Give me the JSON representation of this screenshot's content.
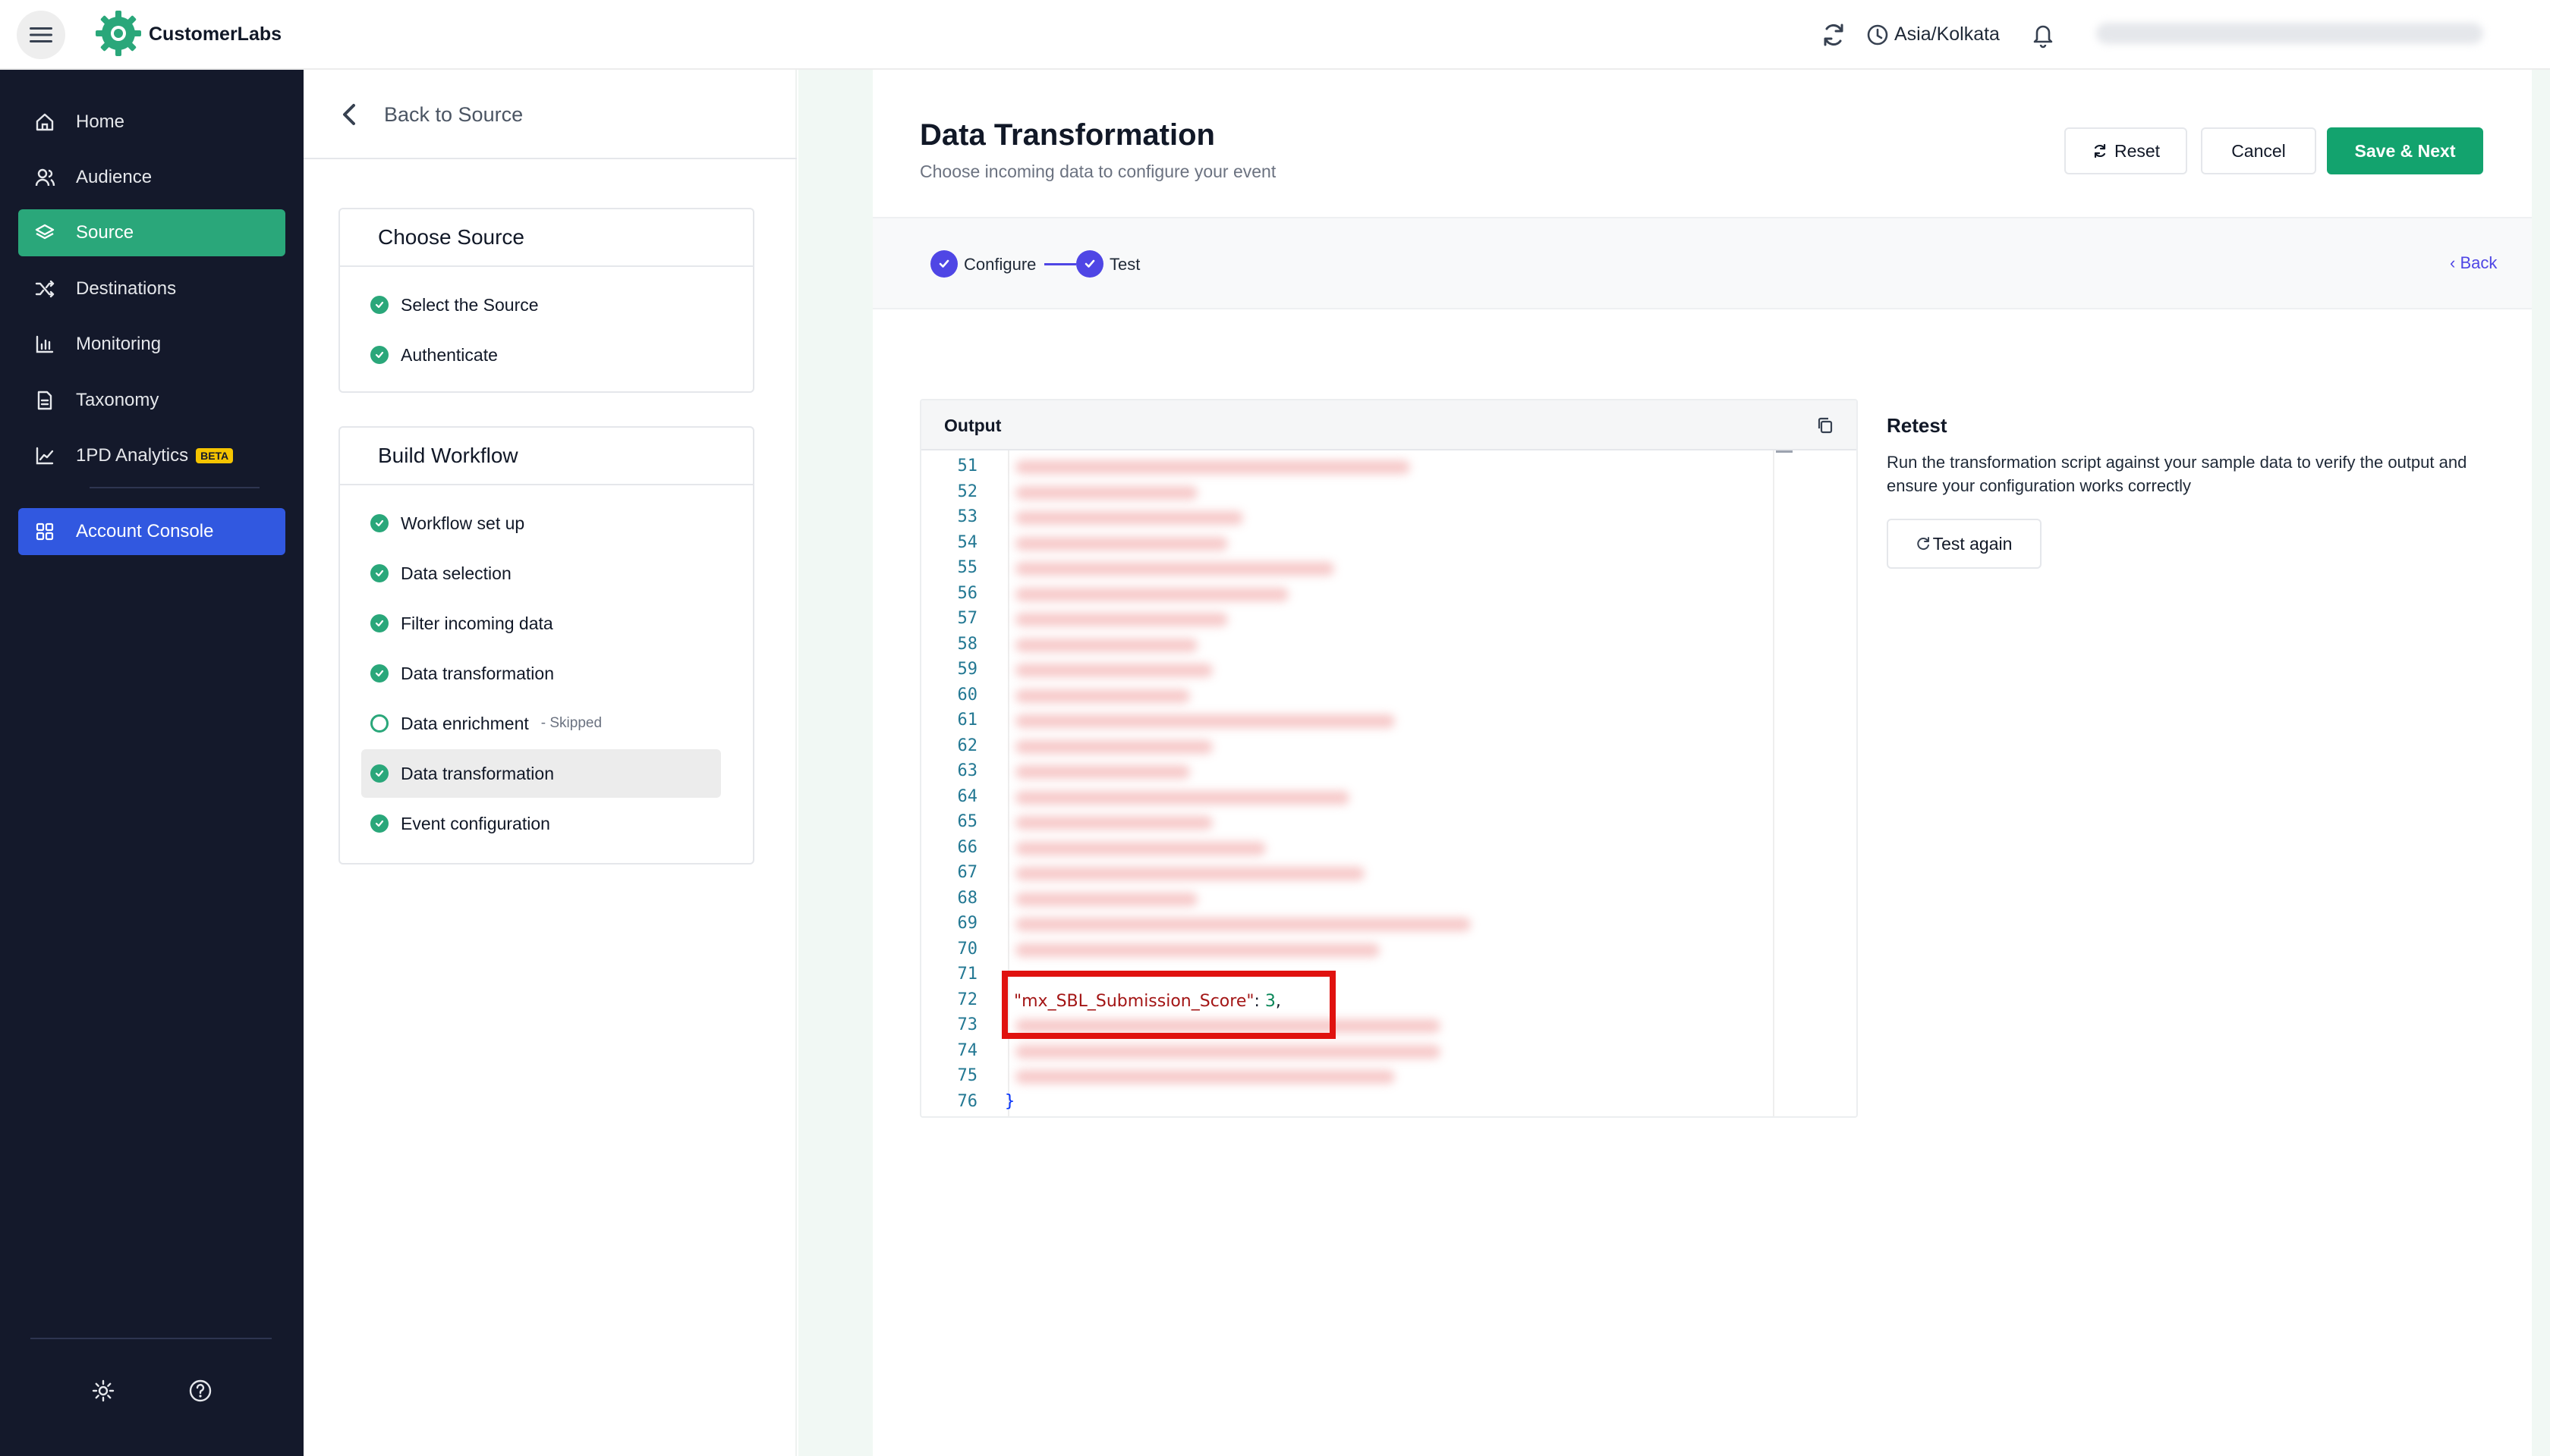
{
  "app": {
    "brand": "CustomerLabs",
    "timezone": "Asia/Kolkata"
  },
  "colors": {
    "brand_green": "#13a36e",
    "nav_bg": "#14192b",
    "nav_active": "#2aa77a",
    "console_blue": "#3158e0",
    "stepper_indigo": "#4f46e5",
    "highlight_red": "#e0120f"
  },
  "sidebar": {
    "items": [
      {
        "label": "Home",
        "icon": "home-icon"
      },
      {
        "label": "Audience",
        "icon": "users-icon"
      },
      {
        "label": "Source",
        "icon": "layers-icon",
        "active": true
      },
      {
        "label": "Destinations",
        "icon": "shuffle-icon"
      },
      {
        "label": "Monitoring",
        "icon": "bar-chart-icon"
      },
      {
        "label": "Taxonomy",
        "icon": "document-icon"
      },
      {
        "label": "1PD Analytics",
        "icon": "trend-icon",
        "badge": "BETA"
      }
    ],
    "account_console": "Account Console",
    "footer_icons": [
      "settings-icon",
      "help-icon"
    ]
  },
  "workflow": {
    "back_label": "Back to Source",
    "choose_source": {
      "title": "Choose Source",
      "steps": [
        {
          "label": "Select the Source",
          "status": "done"
        },
        {
          "label": "Authenticate",
          "status": "done"
        }
      ]
    },
    "build_workflow": {
      "title": "Build Workflow",
      "steps": [
        {
          "label": "Workflow set up",
          "status": "done"
        },
        {
          "label": "Data selection",
          "status": "done"
        },
        {
          "label": "Filter incoming data",
          "status": "done"
        },
        {
          "label": "Data transformation",
          "status": "done"
        },
        {
          "label": "Data enrichment",
          "status": "skipped",
          "note": "- Skipped"
        },
        {
          "label": "Data transformation",
          "status": "done",
          "current": true
        },
        {
          "label": "Event configuration",
          "status": "done"
        }
      ]
    }
  },
  "main": {
    "title": "Data Transformation",
    "subtitle": "Choose incoming data to configure your event",
    "buttons": {
      "reset": "Reset",
      "cancel": "Cancel",
      "save": "Save & Next"
    },
    "stepper": {
      "steps": [
        "Configure",
        "Test"
      ],
      "back": "Back"
    },
    "output": {
      "title": "Output",
      "line_numbers": [
        "51",
        "52",
        "53",
        "54",
        "55",
        "56",
        "57",
        "58",
        "59",
        "60",
        "61",
        "62",
        "63",
        "64",
        "65",
        "66",
        "67",
        "68",
        "69",
        "70",
        "71",
        "72",
        "73",
        "74",
        "75",
        "76"
      ],
      "highlight": {
        "key": "\"mx_SBL_Submission_Score\"",
        "sep": ": ",
        "value": "3",
        "trail": ","
      },
      "closing_brace": "}"
    },
    "retest": {
      "title": "Retest",
      "description": "Run the transformation script against your sample data to verify the output and ensure your configuration works correctly",
      "button": "Test again"
    }
  }
}
